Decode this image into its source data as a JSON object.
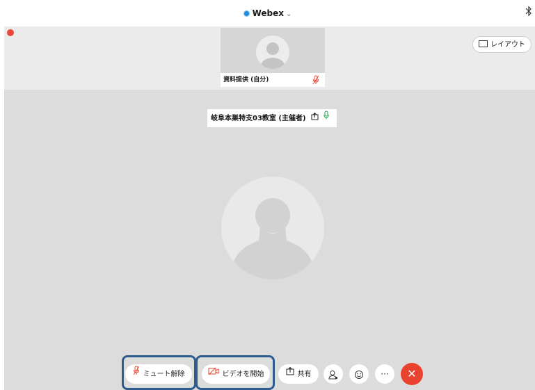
{
  "app": {
    "title": "Webex",
    "title_chevron": "⌄",
    "accent_color": "#1d8ce0"
  },
  "status_bar": {
    "bluetooth_icon": "bluetooth-icon"
  },
  "header": {
    "layout_button_label": "レイアウト",
    "layout_icon": "layout-grid-icon"
  },
  "thumbnail": {
    "name": "資料提供 (自分)",
    "muted": true
  },
  "main_stage": {
    "host_name": "岐阜本巣特支03教室 (主催者)",
    "share_icon": "share-icon",
    "mic_icon": "mic-icon",
    "mic_active_color": "#29a34a"
  },
  "toolbar": {
    "unmute_label": "ミュート解除",
    "start_video_label": "ビデオを開始",
    "share_label": "共有",
    "participants_icon": "participants-icon",
    "reactions_icon": "smiley-icon",
    "more_label": "···",
    "end_icon": "close-icon",
    "end_color": "#e9432f",
    "highlight_color": "#2f5c8f"
  }
}
